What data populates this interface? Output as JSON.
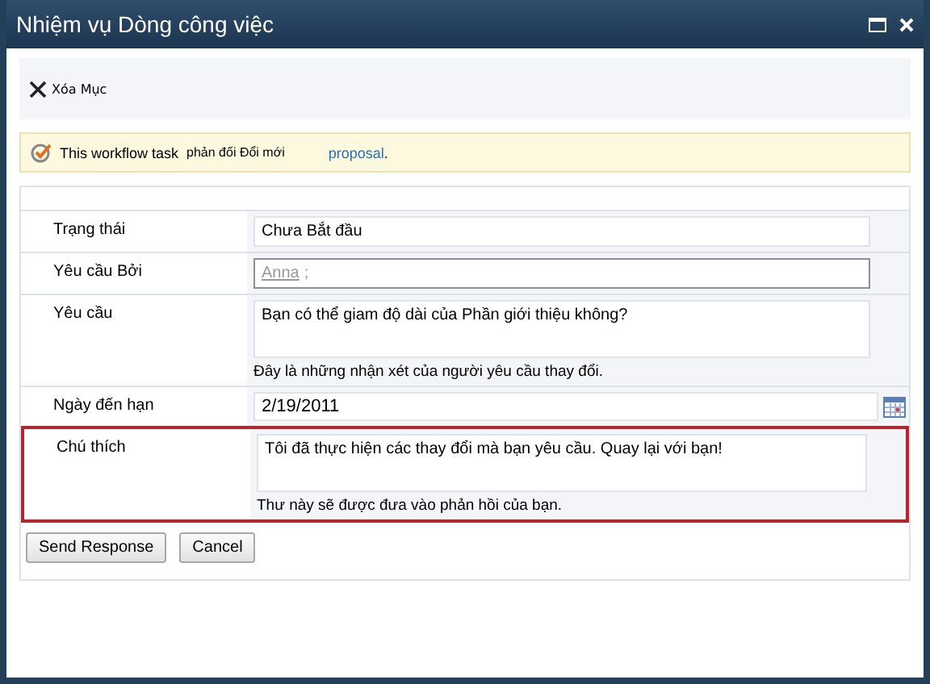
{
  "window": {
    "title": "Nhiệm vụ Dòng công việc"
  },
  "toolbar": {
    "delete_label": "Xóa Mục"
  },
  "info_bar": {
    "text": "This workflow task",
    "text_2": "phản đối Đổi mới",
    "link": "proposal",
    "end": "."
  },
  "fields": [
    {
      "kind": "text",
      "label": "Trạng thái",
      "value": "Chưa Bắt đầu",
      "highlighted": false
    },
    {
      "kind": "people",
      "label": "Yêu cầu Bởi",
      "value": "Anna",
      "suffix": ";",
      "highlighted": false
    },
    {
      "kind": "multiline",
      "label": "Yêu cầu",
      "value": "Bạn có thể giam độ dài của Phần giới thiệu không?",
      "hint": "Đây là những nhận xét của người yêu cầu thay đổi.",
      "highlighted": false
    },
    {
      "kind": "date",
      "label": "Ngày đến hạn",
      "value": "2/19/2011",
      "highlighted": false
    },
    {
      "kind": "multiline",
      "label": "Chú thích",
      "value": "Tôi đã thực hiện các thay đổi mà bạn yêu cầu. Quay lại với bạn!",
      "hint": "Thư này sẽ được đưa vào phản hồi của bạn.",
      "highlighted": true
    }
  ],
  "buttons": [
    "Send Response",
    "Cancel"
  ]
}
